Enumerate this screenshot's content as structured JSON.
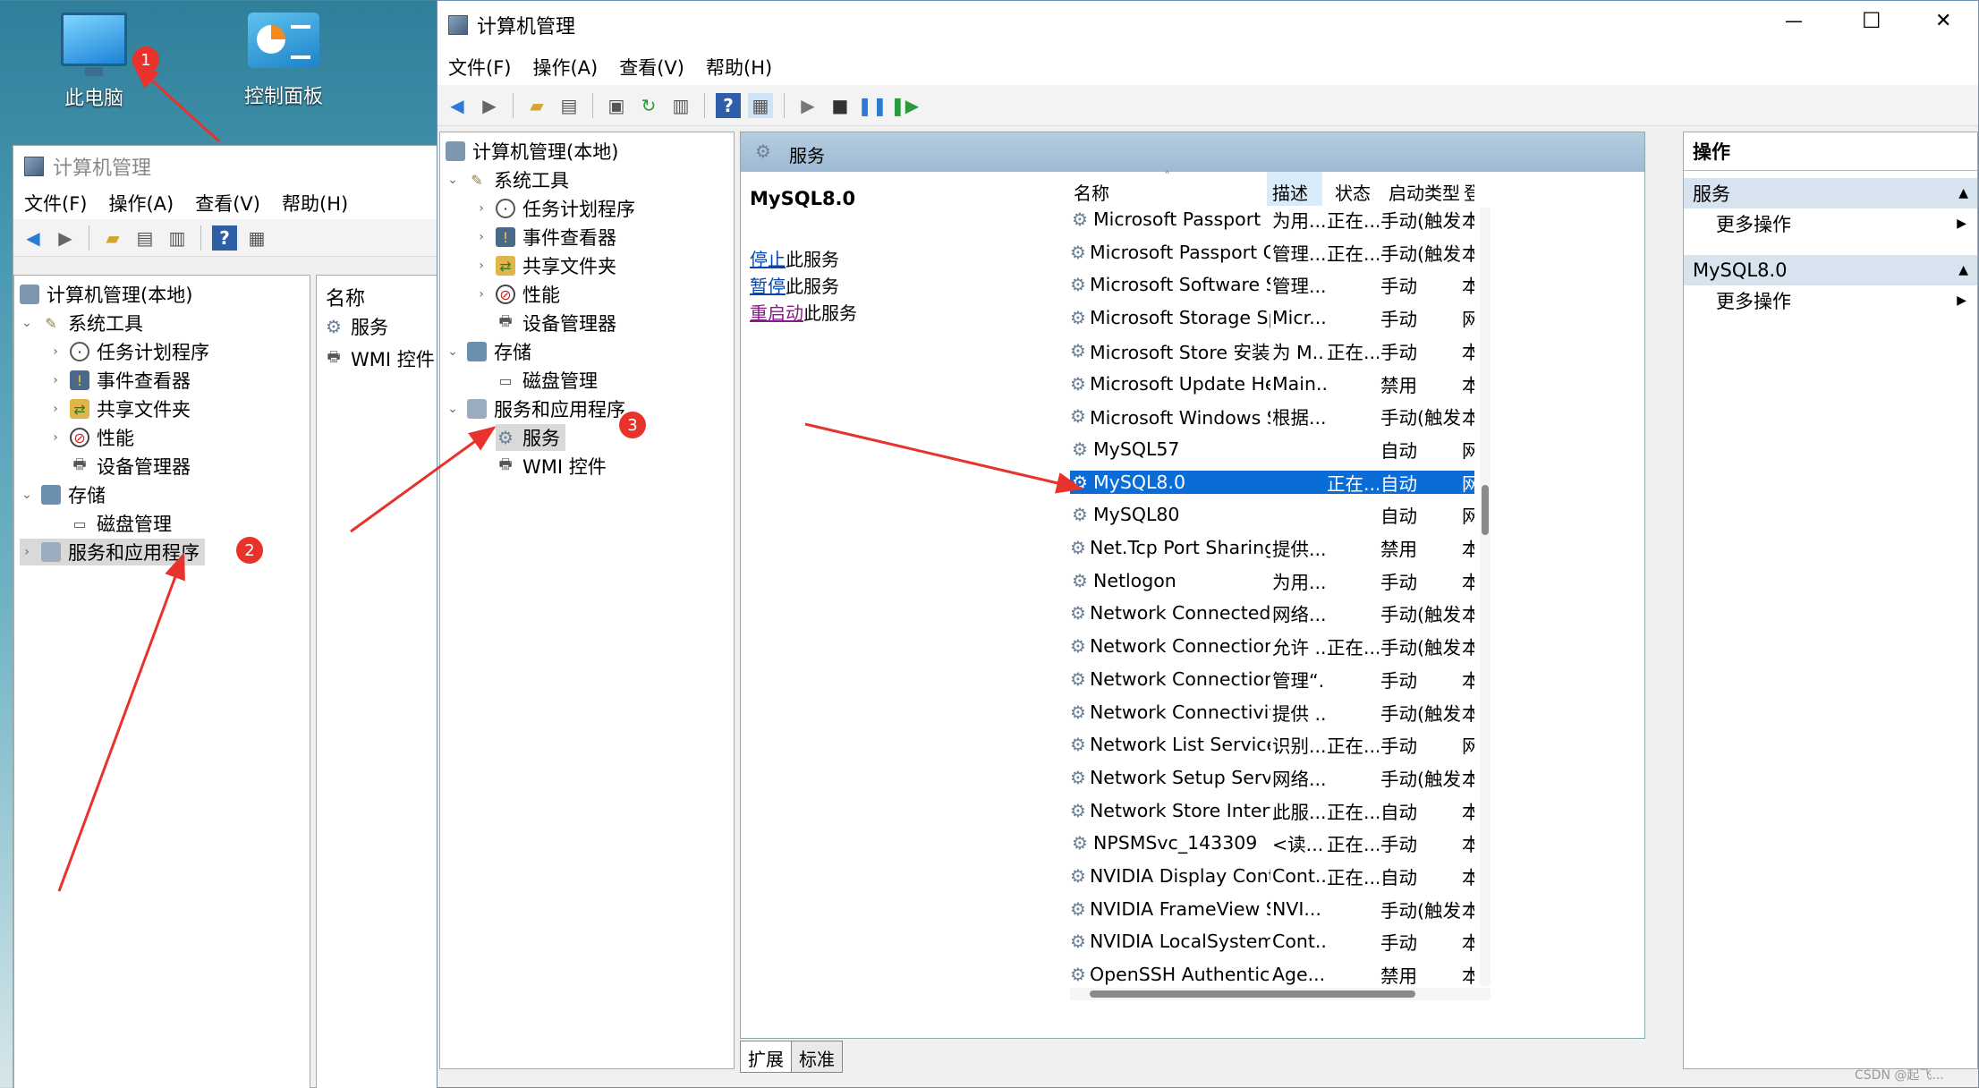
{
  "desktop": {
    "icons": [
      {
        "label": "此电脑",
        "icon": "computer-icon"
      },
      {
        "label": "控制面板",
        "icon": "control-panel-icon"
      }
    ]
  },
  "annotations": {
    "badges": [
      "1",
      "2",
      "3"
    ],
    "arrow_color": "#e8322c"
  },
  "back_window": {
    "title": "计算机管理",
    "menu": [
      "文件(F)",
      "操作(A)",
      "查看(V)",
      "帮助(H)"
    ],
    "tree": {
      "root": "计算机管理(本地)",
      "system_tools": "系统工具",
      "task_scheduler": "任务计划程序",
      "event_viewer": "事件查看器",
      "shared_folders": "共享文件夹",
      "performance": "性能",
      "device_manager": "设备管理器",
      "storage": "存储",
      "disk_management": "磁盘管理",
      "services_apps": "服务和应用程序"
    },
    "list_header": "名称",
    "list_items": [
      "服务",
      "WMI 控件"
    ]
  },
  "main_window": {
    "title": "计算机管理",
    "controls": {
      "minimize": "—",
      "maximize": "☐",
      "close": "✕"
    },
    "menu": [
      "文件(F)",
      "操作(A)",
      "查看(V)",
      "帮助(H)"
    ],
    "tree": {
      "root": "计算机管理(本地)",
      "system_tools": "系统工具",
      "task_scheduler": "任务计划程序",
      "event_viewer": "事件查看器",
      "shared_folders": "共享文件夹",
      "performance": "性能",
      "device_manager": "设备管理器",
      "storage": "存储",
      "disk_management": "磁盘管理",
      "services_apps": "服务和应用程序",
      "services": "服务",
      "wmi": "WMI 控件"
    },
    "services_panel": {
      "header": "服务",
      "selected_service": "MySQL8.0",
      "actions": [
        {
          "link": "停止",
          "rest": "此服务"
        },
        {
          "link": "暂停",
          "rest": "此服务"
        },
        {
          "link": "重启动",
          "rest": "此服务"
        }
      ],
      "columns": {
        "name": "名称",
        "desc": "描述",
        "status": "状态",
        "startup": "启动类型",
        "logon": "登"
      },
      "rows": [
        {
          "name": "Microsoft Passport",
          "desc": "为用...",
          "status": "正在...",
          "startup": "手动(触发...",
          "logon": "本"
        },
        {
          "name": "Microsoft Passport Container",
          "desc": "管理...",
          "status": "正在...",
          "startup": "手动(触发...",
          "logon": "本"
        },
        {
          "name": "Microsoft Software Shado...",
          "desc": "管理...",
          "status": "",
          "startup": "手动",
          "logon": "本"
        },
        {
          "name": "Microsoft Storage Spaces S...",
          "desc": "Micr...",
          "status": "",
          "startup": "手动",
          "logon": "网"
        },
        {
          "name": "Microsoft Store 安装服务",
          "desc": "为 M...",
          "status": "正在...",
          "startup": "手动",
          "logon": "本"
        },
        {
          "name": "Microsoft Update Health S...",
          "desc": "Main...",
          "status": "",
          "startup": "禁用",
          "logon": "本"
        },
        {
          "name": "Microsoft Windows SMS 路...",
          "desc": "根据...",
          "status": "",
          "startup": "手动(触发...",
          "logon": "本"
        },
        {
          "name": "MySQL57",
          "desc": "",
          "status": "",
          "startup": "自动",
          "logon": "网"
        },
        {
          "name": "MySQL8.0",
          "desc": "",
          "status": "正在...",
          "startup": "自动",
          "logon": "网"
        },
        {
          "name": "MySQL80",
          "desc": "",
          "status": "",
          "startup": "自动",
          "logon": "网"
        },
        {
          "name": "Net.Tcp Port Sharing Service",
          "desc": "提供...",
          "status": "",
          "startup": "禁用",
          "logon": "本"
        },
        {
          "name": "Netlogon",
          "desc": "为用...",
          "status": "",
          "startup": "手动",
          "logon": "本"
        },
        {
          "name": "Network Connected Devic...",
          "desc": "网络...",
          "status": "",
          "startup": "手动(触发...",
          "logon": "本"
        },
        {
          "name": "Network Connection Broker",
          "desc": "允许 ...",
          "status": "正在...",
          "startup": "手动(触发...",
          "logon": "本"
        },
        {
          "name": "Network Connections",
          "desc": "管理“...",
          "status": "",
          "startup": "手动",
          "logon": "本"
        },
        {
          "name": "Network Connectivity Assis...",
          "desc": "提供 ...",
          "status": "",
          "startup": "手动(触发...",
          "logon": "本"
        },
        {
          "name": "Network List Service",
          "desc": "识别...",
          "status": "正在...",
          "startup": "手动",
          "logon": "网"
        },
        {
          "name": "Network Setup Service",
          "desc": "网络...",
          "status": "",
          "startup": "手动(触发...",
          "logon": "本"
        },
        {
          "name": "Network Store Interface Se...",
          "desc": "此服...",
          "status": "正在...",
          "startup": "自动",
          "logon": "本"
        },
        {
          "name": "NPSMSvc_143309",
          "desc": "<读...",
          "status": "正在...",
          "startup": "手动",
          "logon": "本"
        },
        {
          "name": "NVIDIA Display Container LS",
          "desc": "Cont...",
          "status": "正在...",
          "startup": "自动",
          "logon": "本"
        },
        {
          "name": "NVIDIA FrameView SDK se...",
          "desc": "NVI...",
          "status": "",
          "startup": "手动(触发...",
          "logon": "本"
        },
        {
          "name": "NVIDIA LocalSystem Conta...",
          "desc": "Cont...",
          "status": "",
          "startup": "手动",
          "logon": "本"
        },
        {
          "name": "OpenSSH Authentication ...",
          "desc": "Age...",
          "status": "",
          "startup": "禁用",
          "logon": "本"
        }
      ],
      "selected_index": 8,
      "tabs": [
        "扩展",
        "标准"
      ]
    },
    "actions_pane": {
      "title": "操作",
      "sections": [
        {
          "header": "服务",
          "item": "更多操作"
        },
        {
          "header": "MySQL8.0",
          "item": "更多操作"
        }
      ]
    }
  },
  "watermark": "CSDN @起飞..."
}
